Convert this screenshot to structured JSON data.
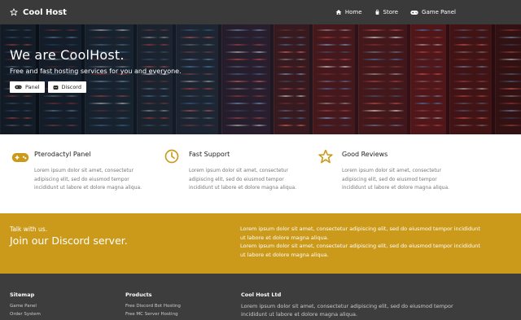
{
  "navbar": {
    "brand": "Cool Host",
    "links": [
      {
        "label": "Home",
        "icon": "home-icon"
      },
      {
        "label": "Store",
        "icon": "bag-icon"
      },
      {
        "label": "Game Panel",
        "icon": "gamepad-icon"
      }
    ]
  },
  "hero": {
    "title": "We are CoolHost.",
    "subtitle": "Free and fast hosting services for you and everyone.",
    "buttons": [
      {
        "label": "Panel",
        "icon": "gamepad-icon"
      },
      {
        "label": "Discord",
        "icon": "discord-icon"
      }
    ]
  },
  "features": [
    {
      "title": "Pterodactyl Panel",
      "icon": "gamepad-icon",
      "text": "Lorem ipsum dolor sit amet, consectetur adipiscing elit, sed do eiusmod tempor incididunt ut labore et dolore magna aliqua."
    },
    {
      "title": "Fast Support",
      "icon": "clock-icon",
      "text": "Lorem ipsum dolor sit amet, consectetur adipiscing elit, sed do eiusmod tempor incididunt ut labore et dolore magna aliqua."
    },
    {
      "title": "Good Reviews",
      "icon": "star-icon",
      "text": "Lorem ipsum dolor sit amet, consectetur adipiscing elit, sed do eiusmod tempor incididunt ut labore et dolore magna aliqua."
    }
  ],
  "banner": {
    "small": "Talk with us.",
    "big": "Join our Discord server.",
    "text1": "Lorem ipsum dolor sit amet, consectetur adipiscing elit, sed do eiusmod tempor incididunt ut labore et dolore magna aliqua.",
    "text2": "Lorem ipsum dolor sit amet, consectetur adipiscing elit, sed do eiusmod tempor incididunt ut labore et dolore magna aliqua."
  },
  "footer": {
    "sitemap": {
      "heading": "Sitemap",
      "links": [
        "Game Panel",
        "Order System"
      ]
    },
    "products": {
      "heading": "Products",
      "links": [
        "Free Discord Bot Hosting",
        "Free MC Server Hosting"
      ]
    },
    "about": {
      "heading": "Cool Host Ltd",
      "text": "Lorem ipsum dolor sit amet, consectetur adipiscing elit, sed do eiusmod tempor incididunt ut labore et dolore magna aliqua."
    }
  },
  "colors": {
    "navbar": "#3a3a3a",
    "accent": "#cc9a1a",
    "footer": "#3d3d3d"
  }
}
